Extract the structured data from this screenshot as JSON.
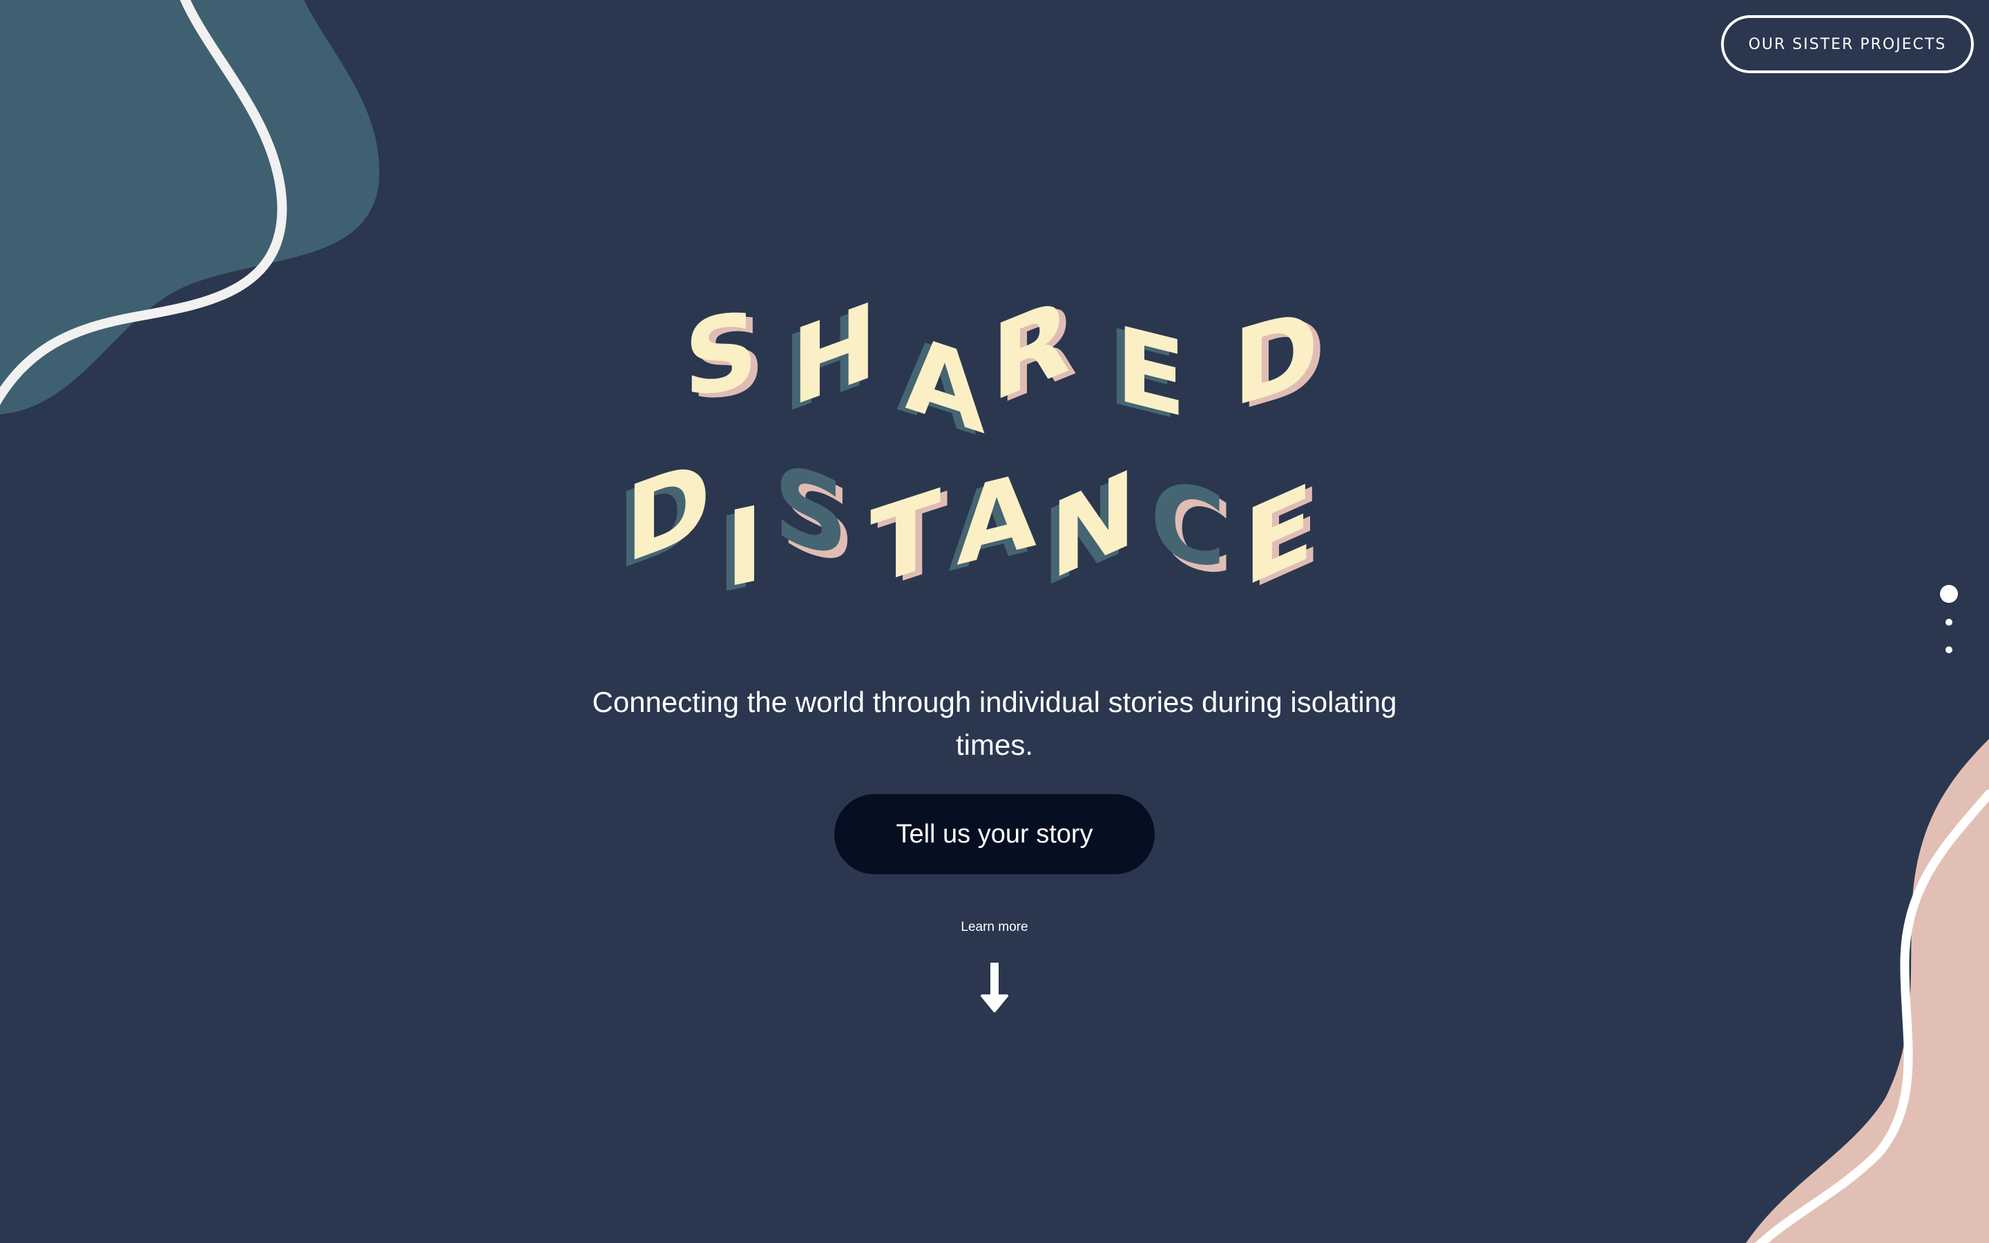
{
  "header": {
    "sister_projects_label": "OUR SISTER PROJECTS"
  },
  "hero": {
    "logo_line1": [
      "S",
      "H",
      "A",
      "R",
      "E",
      "D"
    ],
    "logo_line2": [
      "D",
      "I",
      "S",
      "T",
      "A",
      "N",
      "C",
      "E"
    ],
    "tagline_line1": "Connecting the world through individual stories during isolating",
    "tagline_line2": "times.",
    "cta_label": "Tell us your story",
    "learn_more_label": "Learn more"
  },
  "pager": {
    "pages": 3,
    "active_index": 0
  },
  "colors": {
    "background": "#2a374f",
    "blob_teal": "#3f6070",
    "blob_pink": "#e2bfb4",
    "letter_face": "#fbefc6",
    "letter_side_pink": "#e0bdb4",
    "letter_side_teal": "#456572",
    "cta_background": "#050f21",
    "text": "#ffffff"
  },
  "icons": {
    "learn_more": "arrow-down-icon"
  }
}
